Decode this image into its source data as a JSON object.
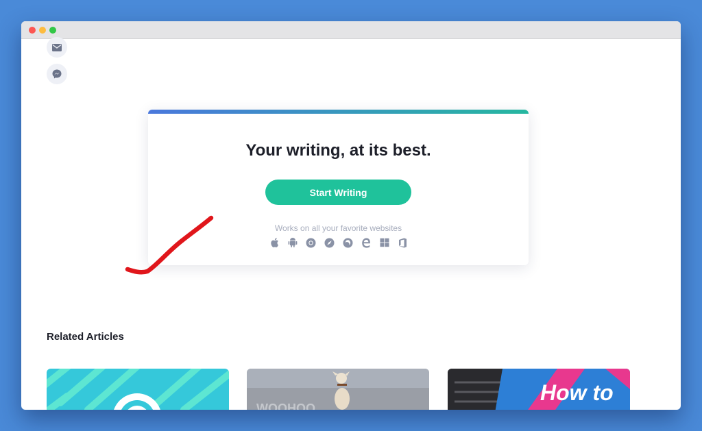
{
  "share": {
    "email_icon": "envelope-icon",
    "messenger_icon": "messenger-icon"
  },
  "cta": {
    "title": "Your writing, at its best.",
    "button_label": "Start Writing",
    "works_text": "Works on all your favorite websites",
    "platform_icons": [
      "apple-icon",
      "android-icon",
      "chrome-icon",
      "safari-icon",
      "firefox-icon",
      "edge-icon",
      "windows-icon",
      "office-icon"
    ]
  },
  "related": {
    "title": "Related Articles",
    "articles": [
      {
        "image_text": ""
      },
      {
        "image_text": "WOOHOO"
      },
      {
        "image_text": "How to"
      }
    ]
  },
  "colors": {
    "brand_green": "#1fc29b",
    "gradient_start": "#4a78dc",
    "gradient_end": "#26b7a0",
    "annotation_red": "#e0161b"
  }
}
